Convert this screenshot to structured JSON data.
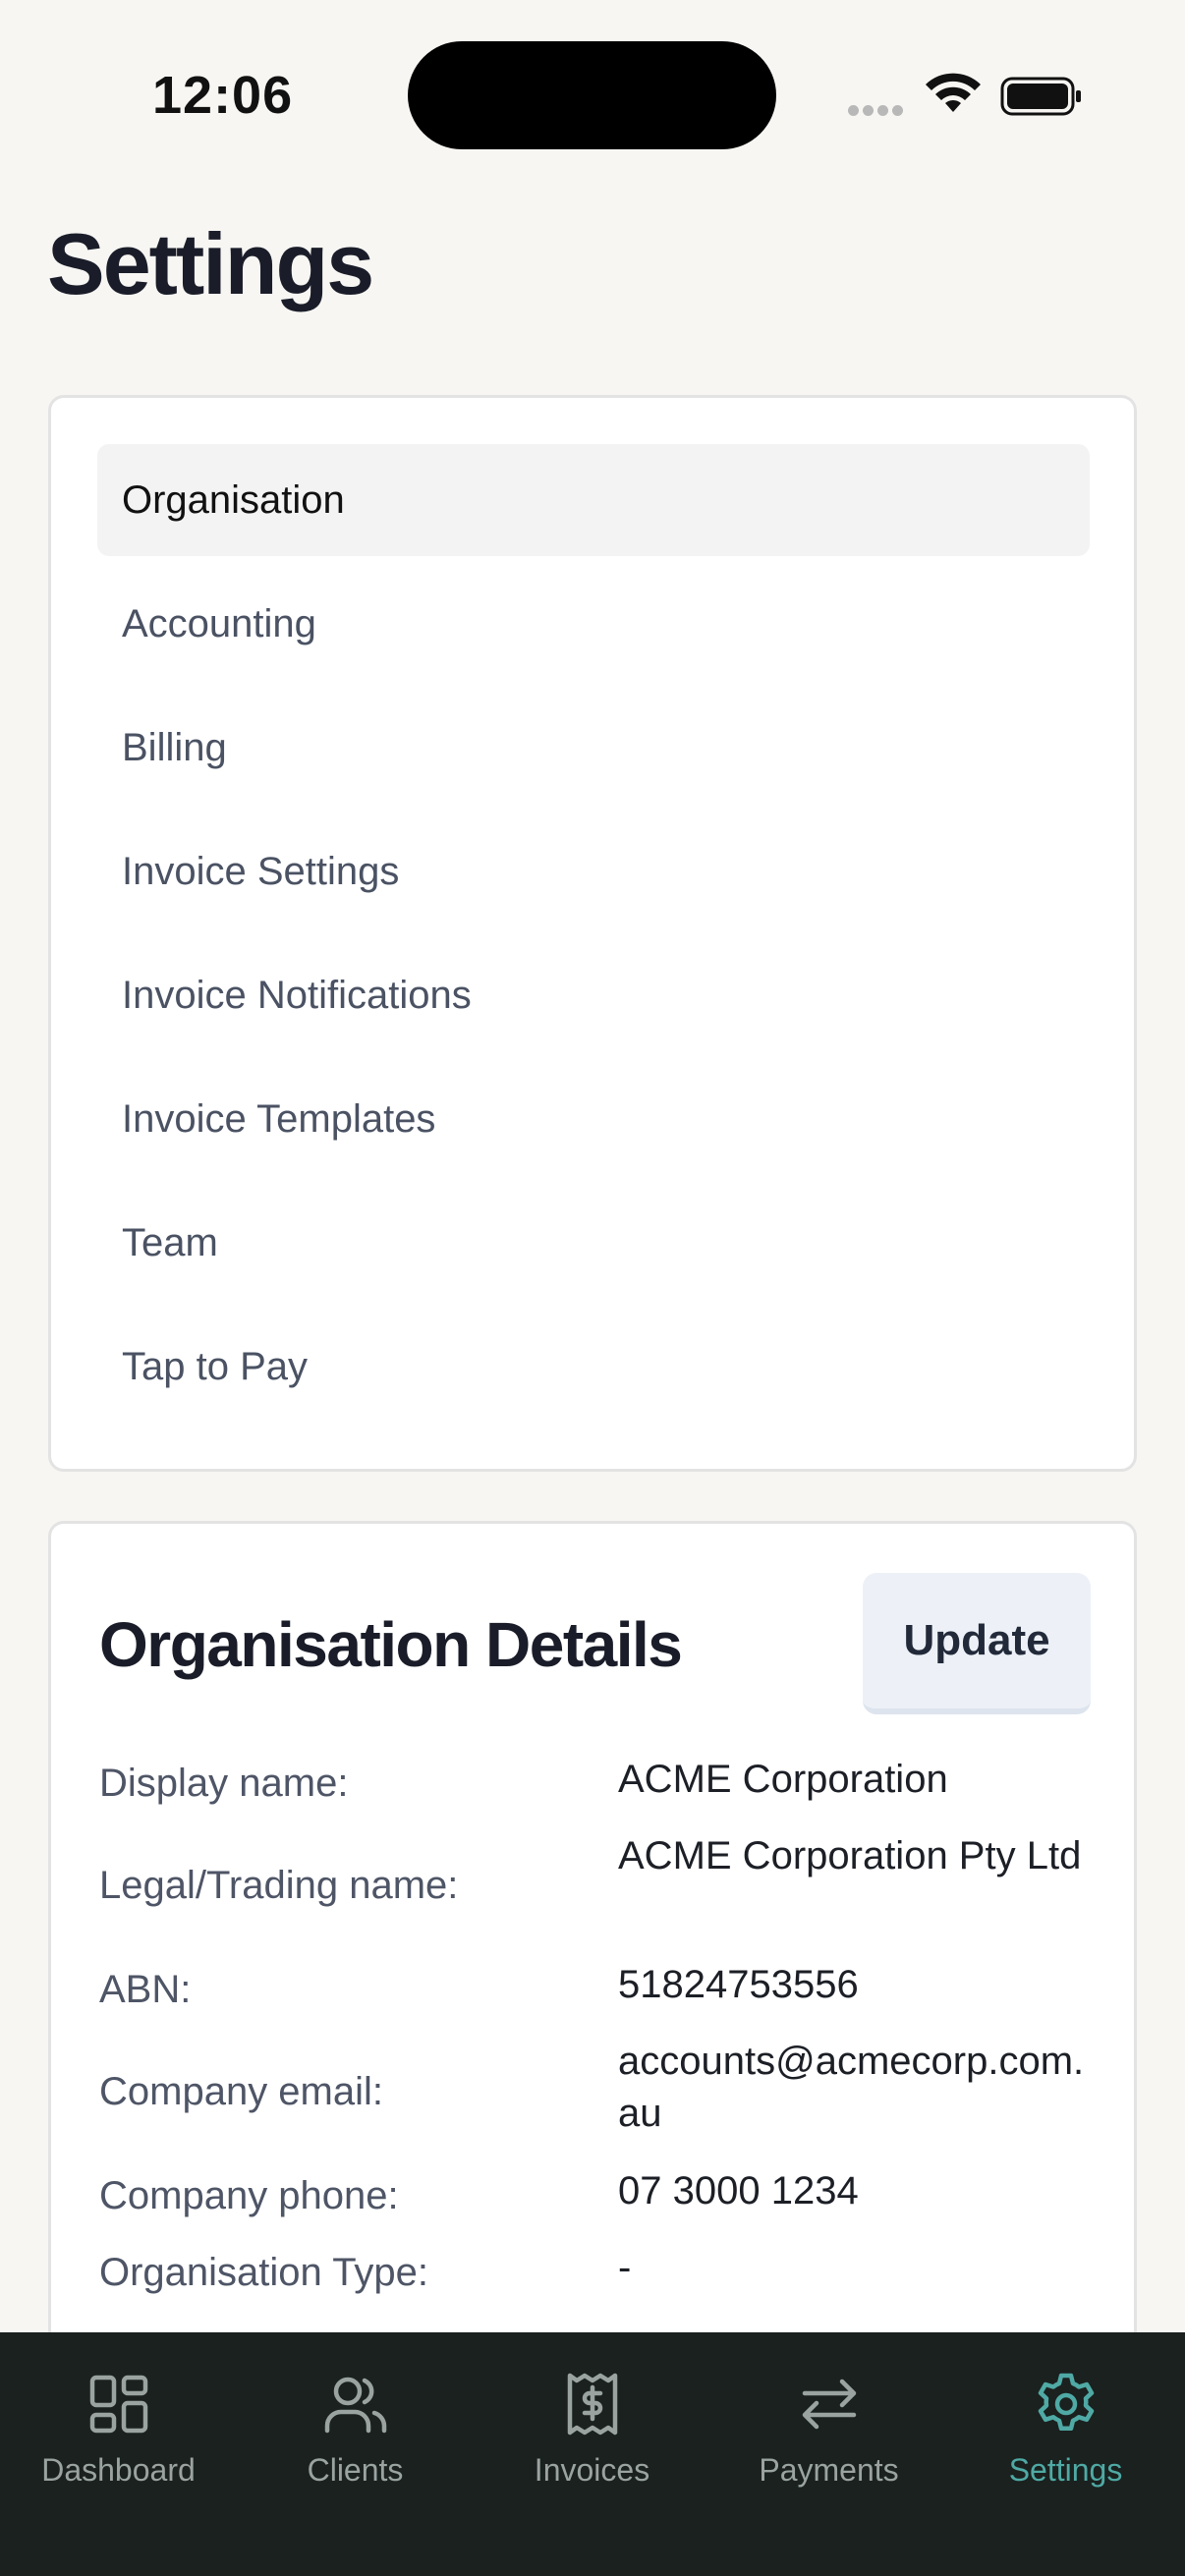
{
  "status_bar": {
    "time": "12:06"
  },
  "page": {
    "title": "Settings"
  },
  "menu": {
    "items": [
      {
        "label": "Organisation",
        "active": true
      },
      {
        "label": "Accounting"
      },
      {
        "label": "Billing"
      },
      {
        "label": "Invoice Settings"
      },
      {
        "label": "Invoice Notifications"
      },
      {
        "label": "Invoice Templates"
      },
      {
        "label": "Team"
      },
      {
        "label": "Tap to Pay"
      }
    ]
  },
  "details": {
    "title": "Organisation Details",
    "update_label": "Update",
    "rows": [
      {
        "label": "Display name:",
        "value": "ACME Corporation"
      },
      {
        "label": "Legal/Trading name:",
        "value": "ACME Corporation Pty Ltd"
      },
      {
        "label": "ABN:",
        "value": "51824753556"
      },
      {
        "label": "Company email:",
        "value": "accounts@acmecorp.com.au"
      },
      {
        "label": "Company phone:",
        "value": "07 3000 1234"
      },
      {
        "label": "Organisation Type:",
        "value": "-"
      }
    ]
  },
  "tabs": [
    {
      "label": "Dashboard",
      "icon": "dashboard-icon"
    },
    {
      "label": "Clients",
      "icon": "users-icon"
    },
    {
      "label": "Invoices",
      "icon": "receipt-dollar-icon"
    },
    {
      "label": "Payments",
      "icon": "arrows-swap-icon"
    },
    {
      "label": "Settings",
      "icon": "gear-icon",
      "active": true
    }
  ],
  "colors": {
    "accent": "#4fa9a4",
    "tab_bar_bg": "#1a211f",
    "page_bg": "#f7f6f3"
  }
}
